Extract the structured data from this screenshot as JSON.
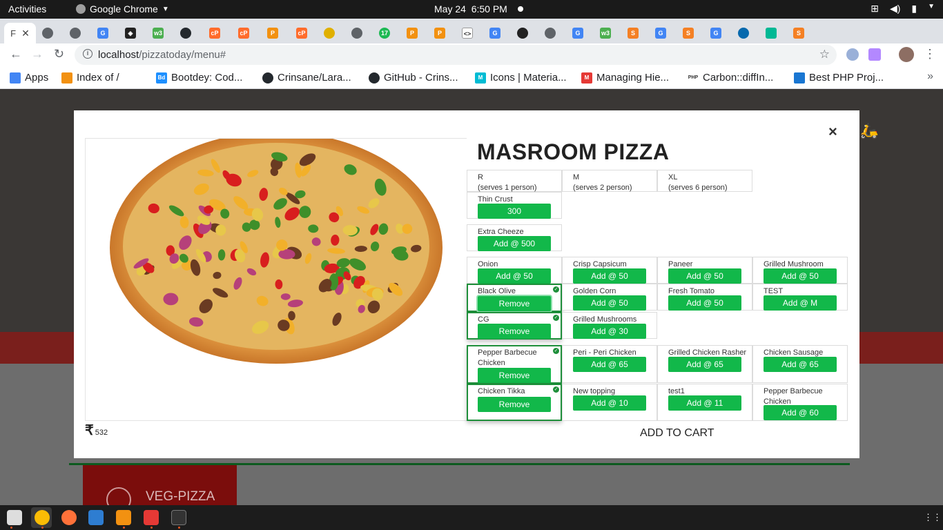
{
  "topbar": {
    "activities": "Activities",
    "app_name": "Google Chrome",
    "date": "May 24",
    "time": "6:50 PM"
  },
  "tabs": {
    "active_label": "F",
    "new_tab": "+"
  },
  "omnibox": {
    "host": "localhost",
    "path": "/pizzatoday/menu#"
  },
  "bookmarks": [
    {
      "label": "Apps",
      "color": "#4285f4"
    },
    {
      "label": "Index of /",
      "color": "#f29111"
    },
    {
      "label": "Bootdey: Cod...",
      "color": "#1e90ff"
    },
    {
      "label": "Crinsane/Lara...",
      "color": "#24292e"
    },
    {
      "label": "GitHub - Crins...",
      "color": "#24292e"
    },
    {
      "label": "Icons | Materia...",
      "color": "#00bcd4"
    },
    {
      "label": "Managing Hie...",
      "color": "#e53935"
    },
    {
      "label": "Carbon::diffIn...",
      "color": "#777"
    },
    {
      "label": "Best PHP Proj...",
      "color": "#1976d2"
    }
  ],
  "modal": {
    "title": "MASROOM PIZZA",
    "close": "×",
    "currency": "₹",
    "price": "532",
    "add_to_cart": "ADD TO CART",
    "sizes": [
      {
        "name": "R",
        "sub": "(serves 1 person)"
      },
      {
        "name": "M",
        "sub": "(serves 2 person)"
      },
      {
        "name": "XL",
        "sub": "(serves 6 person)"
      }
    ],
    "crust": {
      "name": "Thin Crust",
      "button": "300"
    },
    "cheese": {
      "name": "Extra Cheeze",
      "button": "Add @ 500"
    },
    "veg_toppings": [
      {
        "name": "Onion",
        "button": "Add @ 50"
      },
      {
        "name": "Crisp Capsicum",
        "button": "Add @ 50"
      },
      {
        "name": "Paneer",
        "button": "Add @ 50"
      },
      {
        "name": "Grilled Mushroom",
        "button": "Add @ 50"
      },
      {
        "name": "Black Olive",
        "button": "Remove"
      },
      {
        "name": "Golden Corn",
        "button": "Add @ 50"
      },
      {
        "name": "Fresh Tomato",
        "button": "Add @ 50"
      },
      {
        "name": "TEST",
        "button": "Add @ M"
      },
      {
        "name": "CG",
        "button": "Remove"
      },
      {
        "name": "Grilled Mushrooms",
        "button": "Add @ 30"
      }
    ],
    "nonveg_toppings": [
      {
        "name": "Pepper Barbecue Chicken",
        "button": "Remove"
      },
      {
        "name": "Peri - Peri Chicken",
        "button": "Add @ 65"
      },
      {
        "name": "Grilled Chicken Rasher",
        "button": "Add @ 65"
      },
      {
        "name": "Chicken Sausage",
        "button": "Add @ 65"
      },
      {
        "name": "Chicken Tikka",
        "button": "Remove"
      },
      {
        "name": "New topping",
        "button": "Add @ 10"
      },
      {
        "name": "test1",
        "button": "Add @ 11"
      },
      {
        "name": "Pepper Barbecue Chicken",
        "button": "Add @ 60"
      }
    ]
  },
  "page": {
    "category": "VEG-PIZZA"
  },
  "colors": {
    "accent_green": "#12b84a",
    "selected_border": "#1e8f3a"
  }
}
